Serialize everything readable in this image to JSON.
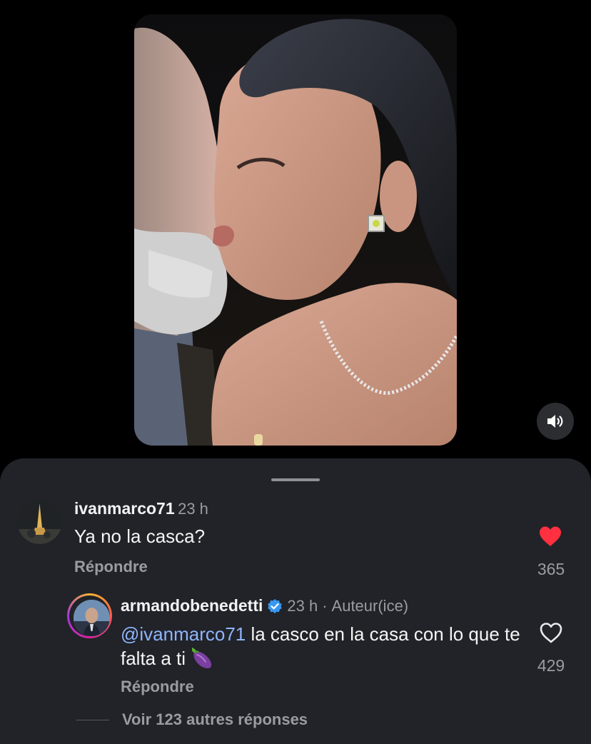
{
  "video": {
    "sound_icon": "speaker-volume-icon"
  },
  "comments": [
    {
      "username": "ivanmarco71",
      "time": "23 h",
      "text": "Ya no la casca?",
      "reply_label": "Répondre",
      "like_count": "365",
      "liked": true,
      "like_color": "#ff3040"
    },
    {
      "username": "armandobenedetti",
      "verified": true,
      "time": "23 h",
      "separator": "·",
      "author_label": "Auteur(ice)",
      "mention": "@ivanmarco71",
      "text": " la casco en la casa con lo que te falta a ti ",
      "emoji": "eggplant-emoji",
      "reply_label": "Répondre",
      "like_count": "429",
      "liked": false
    }
  ],
  "view_more": "Voir 123 autres réponses",
  "colors": {
    "sheet_bg": "#212328",
    "mention": "#8fb4ff",
    "verified": "#3897f0"
  }
}
